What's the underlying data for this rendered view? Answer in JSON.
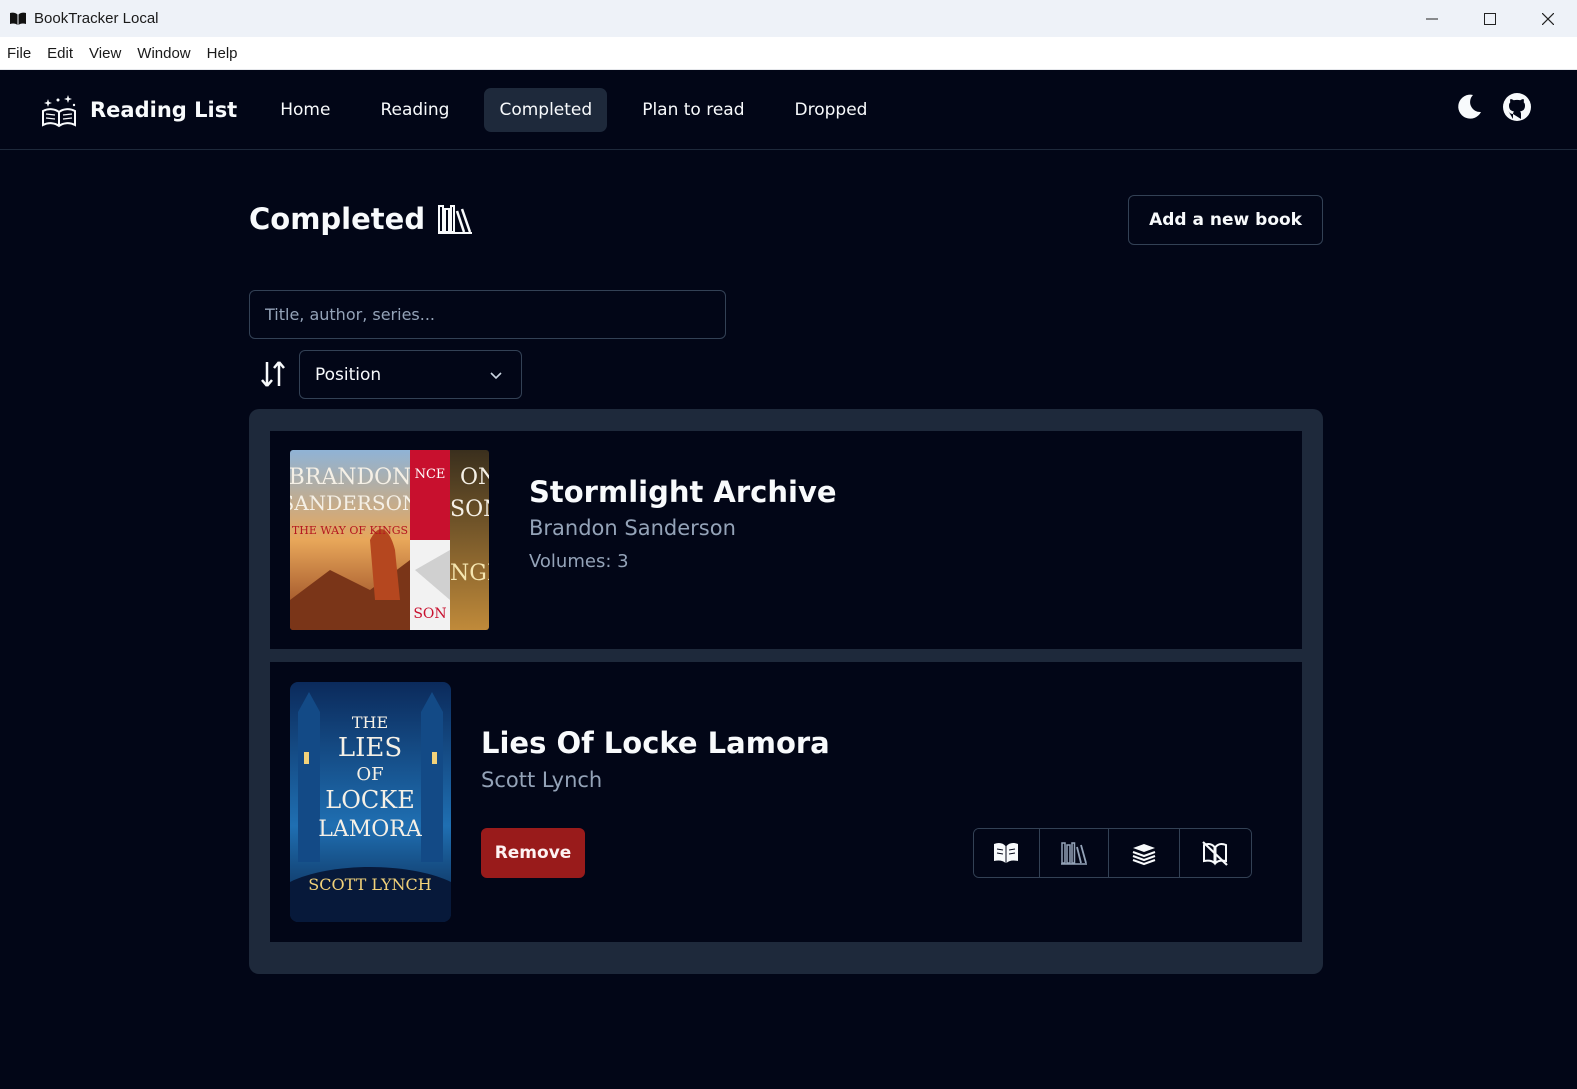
{
  "window": {
    "title": "BookTracker Local",
    "controls": [
      "minimize",
      "maximize",
      "close"
    ]
  },
  "menu": [
    "File",
    "Edit",
    "View",
    "Window",
    "Help"
  ],
  "navbar": {
    "brand": "Reading List",
    "links": [
      {
        "label": "Home",
        "active": false
      },
      {
        "label": "Reading",
        "active": false
      },
      {
        "label": "Completed",
        "active": true
      },
      {
        "label": "Plan to read",
        "active": false
      },
      {
        "label": "Dropped",
        "active": false
      }
    ],
    "icons": [
      "moon-icon",
      "github-icon"
    ]
  },
  "page": {
    "title": "Completed",
    "title_icon": "bookshelf-icon",
    "add_button": "Add a new book"
  },
  "search": {
    "placeholder": "Title, author, series...",
    "value": ""
  },
  "sort": {
    "selected": "Position"
  },
  "books": [
    {
      "title": "Stormlight Archive",
      "author": "Brandon Sanderson",
      "volumes": "Volumes: 3",
      "covers": [
        {
          "lines": [
            "BRANDON",
            "SANDERSON",
            "THE WAY OF KINGS"
          ],
          "colors": [
            "#e8a75a",
            "#b5471f"
          ]
        },
        {
          "lines": [
            "NCE",
            "SON"
          ],
          "colors": [
            "#c8102e",
            "#f2f2f2"
          ]
        },
        {
          "lines": [
            "ON",
            "SON",
            "NGE"
          ],
          "colors": [
            "#3a2f1d",
            "#c08a3a"
          ]
        }
      ]
    },
    {
      "title": "Lies Of Locke Lamora",
      "author": "Scott Lynch",
      "cover_lines": [
        "THE",
        "LIES",
        "OF",
        "LOCKE",
        "LAMORA",
        "SCOTT LYNCH"
      ],
      "cover_colors": [
        "#0b2a5b",
        "#1f6fb2"
      ],
      "remove_label": "Remove",
      "status_actions": [
        "reading-icon",
        "completed-icon",
        "plan-to-read-icon",
        "dropped-icon"
      ]
    }
  ],
  "colors": {
    "background": "#020617",
    "panel": "#1e293b",
    "border": "#334155",
    "muted_text": "#94a3b8",
    "danger": "#991b1b"
  }
}
